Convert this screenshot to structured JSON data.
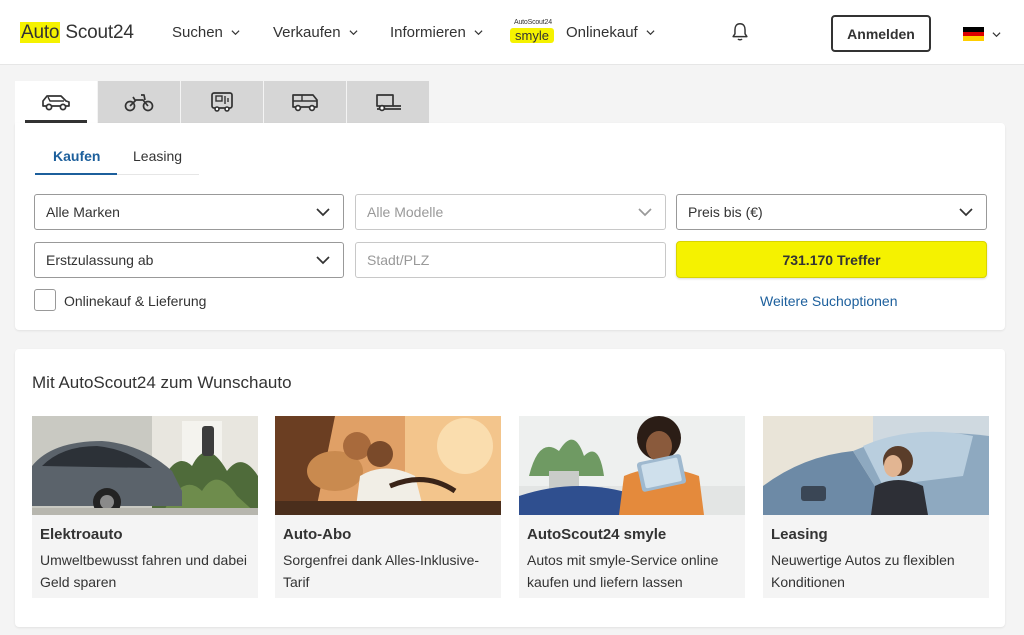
{
  "header": {
    "logo_left": "Auto",
    "logo_right": "Scout24",
    "nav": [
      {
        "label": "Suchen"
      },
      {
        "label": "Verkaufen"
      },
      {
        "label": "Informieren"
      },
      {
        "label": "Onlinekauf"
      }
    ],
    "smyle_small": "AutoScout24",
    "smyle_label": "smyle",
    "login_label": "Anmelden",
    "language": "de"
  },
  "vehicle_tabs": [
    {
      "icon": "car-icon",
      "active": true
    },
    {
      "icon": "motorcycle-icon",
      "active": false
    },
    {
      "icon": "caravan-icon",
      "active": false
    },
    {
      "icon": "van-icon",
      "active": false
    },
    {
      "icon": "truck-icon",
      "active": false
    }
  ],
  "search": {
    "tabs": [
      {
        "label": "Kaufen",
        "active": true
      },
      {
        "label": "Leasing",
        "active": false
      }
    ],
    "make": "Alle Marken",
    "model": "Alle Modelle",
    "price": "Preis bis (€)",
    "first_registration": "Erstzulassung ab",
    "location_placeholder": "Stadt/PLZ",
    "results_label": "731.170 Treffer",
    "online_purchase_label": "Onlinekauf & Lieferung",
    "more_options": "Weitere Suchoptionen"
  },
  "promo": {
    "title": "Mit AutoScout24 zum Wunschauto",
    "cards": [
      {
        "title": "Elektroauto",
        "description": "Umweltbewusst fahren und dabei Geld sparen"
      },
      {
        "title": "Auto-Abo",
        "description": "Sorgenfrei dank Alles-Inklusive-Tarif"
      },
      {
        "title": "AutoScout24 smyle",
        "description": "Autos mit smyle-Service online kaufen und liefern lassen"
      },
      {
        "title": "Leasing",
        "description": "Neuwertige Autos zu flexiblen Konditionen"
      }
    ]
  },
  "colors": {
    "accent_yellow": "#f5f200",
    "link_blue": "#1c5f9c",
    "text": "#333333",
    "background": "#f4f4f4"
  }
}
